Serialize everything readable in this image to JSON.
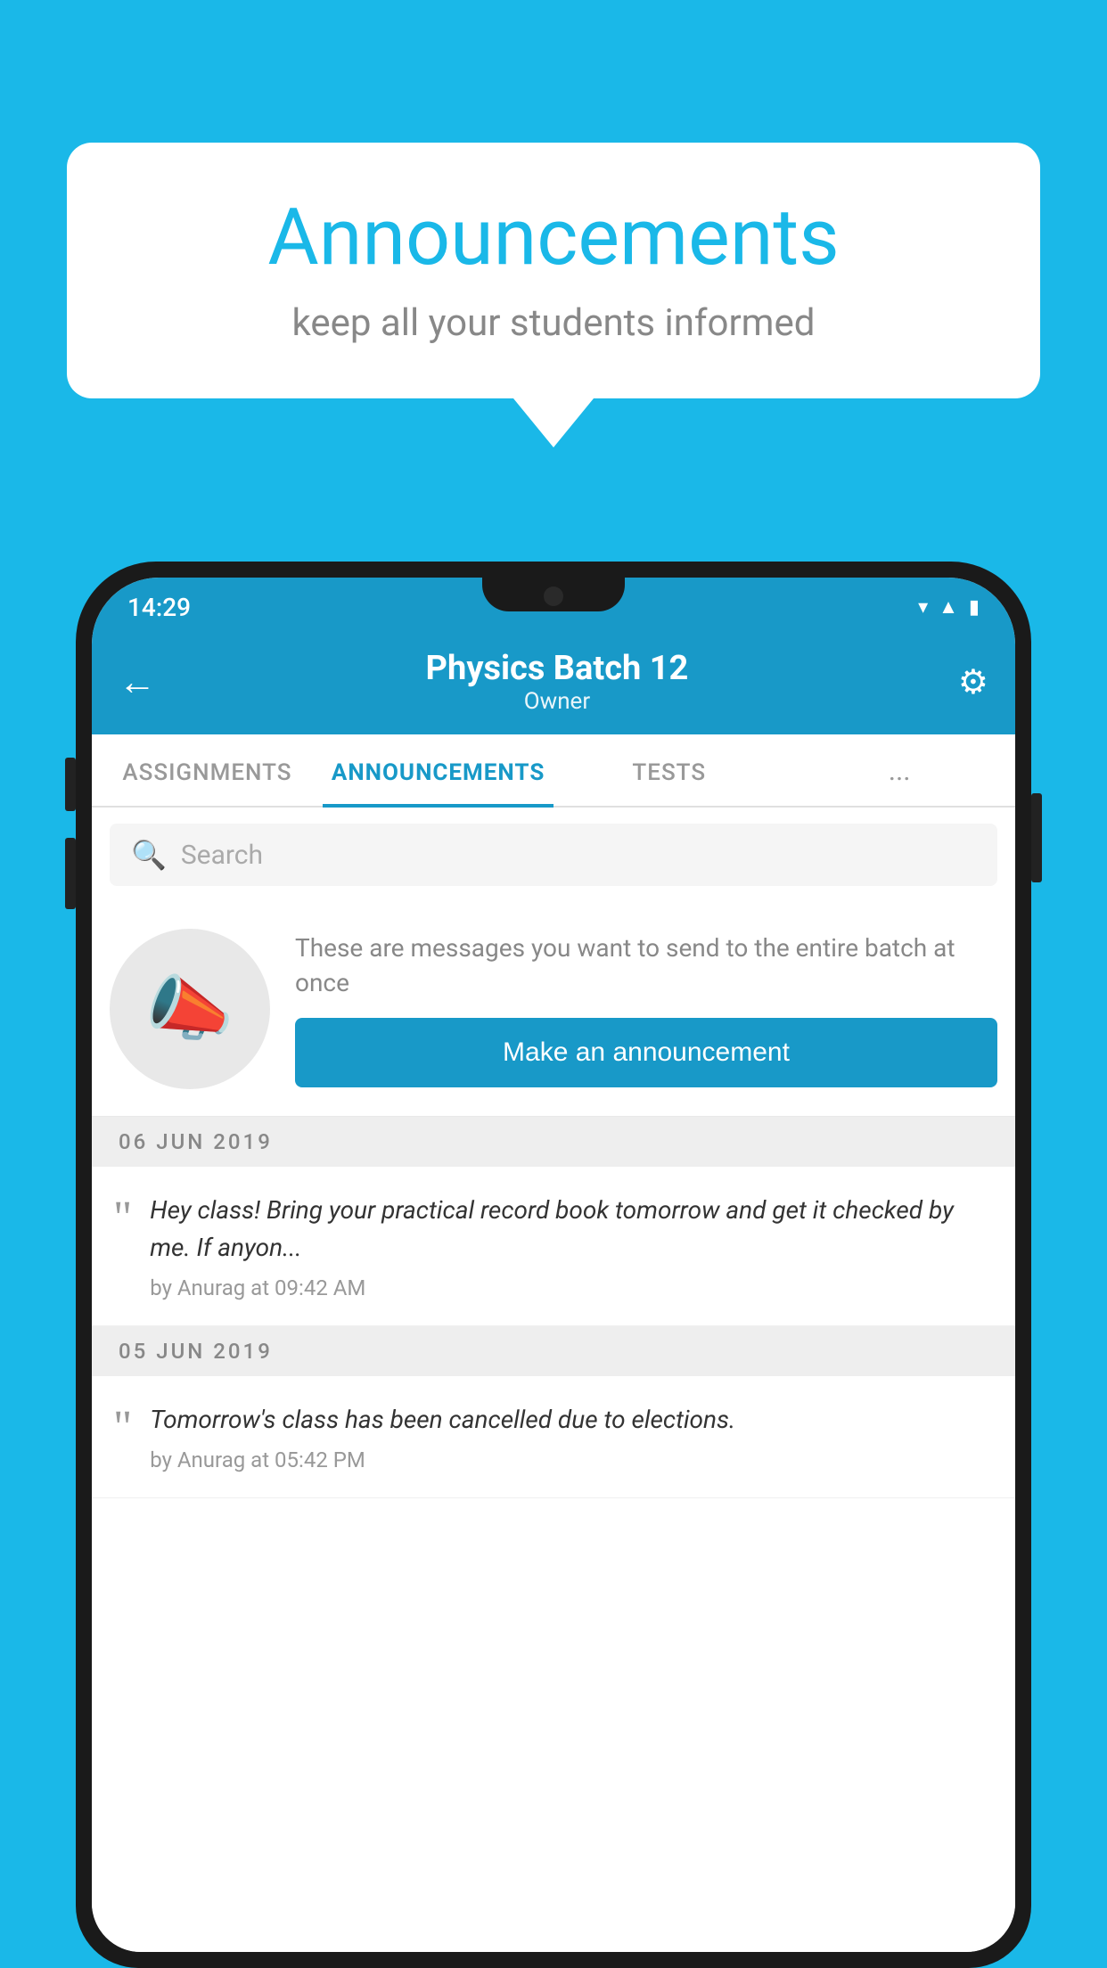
{
  "background_color": "#1ab8e8",
  "speech_bubble": {
    "title": "Announcements",
    "subtitle": "keep all your students informed"
  },
  "phone": {
    "status_bar": {
      "time": "14:29",
      "icons": [
        "wifi",
        "signal",
        "battery"
      ]
    },
    "app_bar": {
      "title": "Physics Batch 12",
      "subtitle": "Owner",
      "back_label": "←",
      "gear_label": "⚙"
    },
    "tabs": [
      {
        "label": "ASSIGNMENTS",
        "active": false
      },
      {
        "label": "ANNOUNCEMENTS",
        "active": true
      },
      {
        "label": "TESTS",
        "active": false
      },
      {
        "label": "...",
        "active": false
      }
    ],
    "search": {
      "placeholder": "Search"
    },
    "empty_state": {
      "description": "These are messages you want to send to the entire batch at once",
      "button_label": "Make an announcement"
    },
    "announcements": [
      {
        "date": "06  JUN  2019",
        "text": "Hey class! Bring your practical record book tomorrow and get it checked by me. If anyon...",
        "meta": "by Anurag at 09:42 AM"
      },
      {
        "date": "05  JUN  2019",
        "text": "Tomorrow's class has been cancelled due to elections.",
        "meta": "by Anurag at 05:42 PM"
      }
    ]
  }
}
